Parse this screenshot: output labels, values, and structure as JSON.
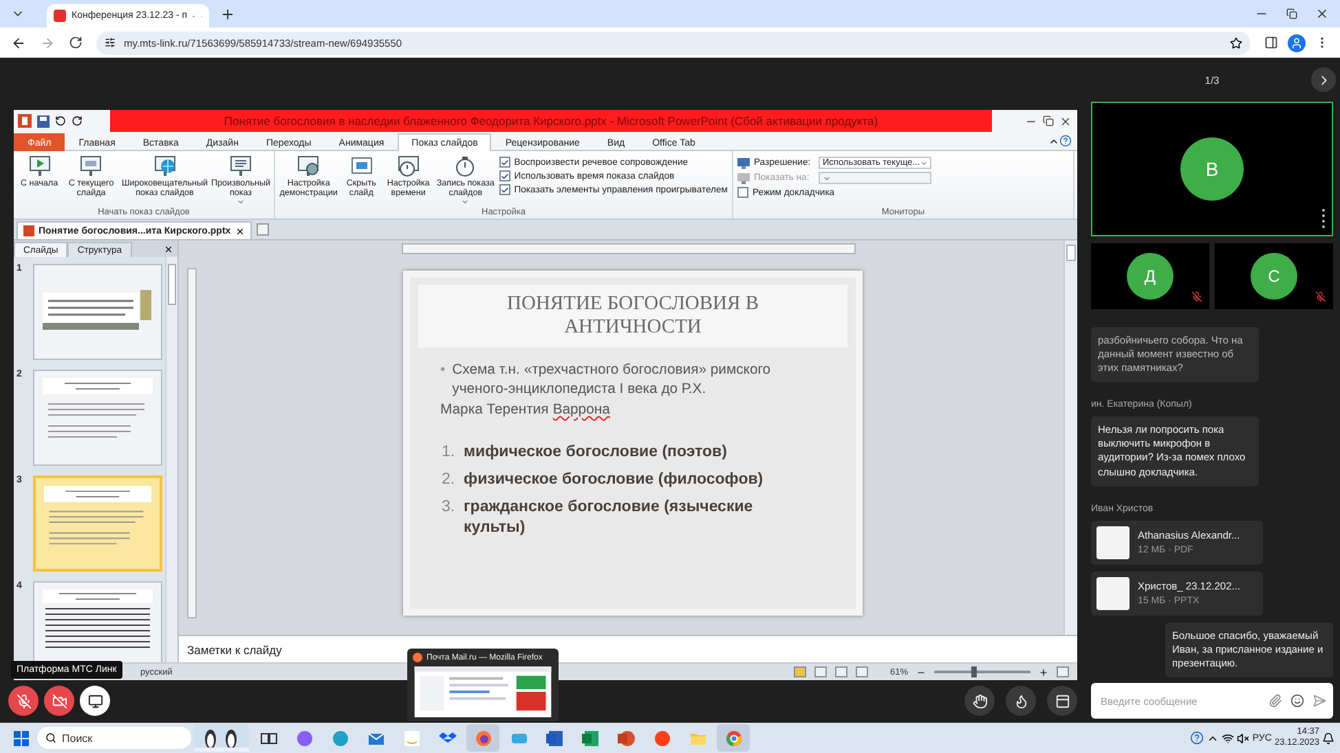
{
  "browser": {
    "tab_title": "Конференция 23.12.23 - п",
    "audio_playing": true,
    "url": "my.mts-link.ru/71563699/585914733/stream-new/694935550"
  },
  "powerpoint": {
    "window_title": "Понятие богословия в наследии блаженного Феодорита Кирского.pptx - Microsoft PowerPoint (Сбой активации продукта)",
    "tabs": [
      {
        "label": "Файл",
        "kind": "file",
        "selected": false
      },
      {
        "label": "Главная",
        "kind": "tab",
        "selected": false
      },
      {
        "label": "Вставка",
        "kind": "tab",
        "selected": false
      },
      {
        "label": "Дизайн",
        "kind": "tab",
        "selected": false
      },
      {
        "label": "Переходы",
        "kind": "tab",
        "selected": false
      },
      {
        "label": "Анимация",
        "kind": "tab",
        "selected": false
      },
      {
        "label": "Показ слайдов",
        "kind": "tab",
        "selected": true
      },
      {
        "label": "Рецензирование",
        "kind": "tab",
        "selected": false
      },
      {
        "label": "Вид",
        "kind": "tab",
        "selected": false
      },
      {
        "label": "Office Tab",
        "kind": "tab",
        "selected": false
      }
    ],
    "ribbon_groups": [
      {
        "label": "Начать показ слайдов",
        "items": [
          {
            "kind": "button",
            "label": "С начала",
            "has_menu": false
          },
          {
            "kind": "button",
            "label": "С текущего слайда",
            "has_menu": false
          },
          {
            "kind": "button",
            "label": "Широковещательный показ слайдов",
            "has_menu": false
          },
          {
            "kind": "button",
            "label": "Произвольный показ",
            "has_menu": true
          }
        ]
      },
      {
        "label": "Настройка",
        "items": [
          {
            "kind": "button",
            "label": "Настройка демонстрации",
            "has_menu": false
          },
          {
            "kind": "button",
            "label": "Скрыть слайд",
            "has_menu": false
          },
          {
            "kind": "button",
            "label": "Настройка времени",
            "has_menu": false
          },
          {
            "kind": "button",
            "label": "Запись показа слайдов",
            "has_menu": true
          },
          {
            "kind": "checkboxes",
            "checkboxes": [
              {
                "label": "Воспроизвести речевое сопровождение",
                "checked": true
              },
              {
                "label": "Использовать время показа слайдов",
                "checked": true
              },
              {
                "label": "Показать элементы управления проигрывателем",
                "checked": true
              }
            ]
          }
        ]
      },
      {
        "label": "Мониторы",
        "items": [
          {
            "kind": "monitors",
            "rows": [
              {
                "label": "Разрешение:",
                "value": "Использовать текуще...",
                "disabled": false
              },
              {
                "label": "Показать на:",
                "disabled": true
              }
            ],
            "checkbox": {
              "label": "Режим докладчика",
              "checked": false
            }
          }
        ]
      }
    ],
    "document_tab": "Понятие богословия...ита Кирского.pptx",
    "pane_tabs": [
      {
        "label": "Слайды",
        "selected": true
      },
      {
        "label": "Структура",
        "selected": false
      }
    ],
    "slides": [
      {
        "number": "1",
        "selected": false
      },
      {
        "number": "2",
        "selected": false
      },
      {
        "number": "3",
        "selected": true
      },
      {
        "number": "4",
        "selected": false
      }
    ],
    "slide": {
      "title": "ПОНЯТИЕ БОГОСЛОВИЯ В АНТИЧНОСТИ",
      "bullet_mark": "•",
      "bullet": "Схема т.н. «трехчастного богословия» римского ученого-энциклопедиста I века до Р.Х.",
      "line": "Марка Терентия",
      "misspelled": "Варрона",
      "list": [
        {
          "number": "1.",
          "text": "мифическое богословие (поэтов)"
        },
        {
          "number": "2.",
          "text": "физическое богословие (философов)"
        },
        {
          "number": "3.",
          "text": "гражданское богословие (языческие культы)"
        }
      ]
    },
    "notes_placeholder": "Заметки к слайду",
    "status": {
      "language": "русский",
      "zoom": {
        "reading": "61%",
        "level": 0.42
      }
    }
  },
  "conference": {
    "page": "1/3",
    "tiles": [
      {
        "initial": "В",
        "speaking": true,
        "muted": false
      },
      {
        "initial": "Д",
        "speaking": false,
        "muted": true
      },
      {
        "initial": "С",
        "speaking": false,
        "muted": true
      }
    ],
    "chat": [
      {
        "kind": "message",
        "text": "разбойничьего собора. Что на данный момент известно об этих памятниках?"
      },
      {
        "kind": "sender",
        "text": "ин. Екатерина (Копыл)"
      },
      {
        "kind": "message",
        "text": "Нельзя ли попросить пока выключить микрофон в аудитории? Из-за помех плохо слышно докладчика."
      },
      {
        "kind": "sender",
        "text": "Иван Христов"
      },
      {
        "kind": "file",
        "name": "Athanasius Alexandr...",
        "meta": "12 МБ · PDF"
      },
      {
        "kind": "file",
        "name": "Христов_ 23.12.202...",
        "meta": "15 МБ · PPTX"
      },
      {
        "kind": "own",
        "text": "Большое спасибо, уважаемый Иван, за присланное издание и презентацию."
      }
    ],
    "message_placeholder": "Введите сообщение",
    "controls": {
      "mic_on": false,
      "camera_on": false
    }
  },
  "tooltip": "Платформа МТС Линк",
  "preview": {
    "title": "Почта Mail.ru — Mozilla Firefox"
  },
  "taskbar": {
    "search_placeholder": "Поиск",
    "apps": [
      {
        "kind": "taskview",
        "active": false
      },
      {
        "kind": "assistant",
        "active": false
      },
      {
        "kind": "edge",
        "active": false
      },
      {
        "kind": "mail",
        "active": false
      },
      {
        "kind": "store",
        "active": false
      },
      {
        "kind": "dropbox",
        "active": false
      },
      {
        "kind": "firefox",
        "active": true
      },
      {
        "kind": "weather",
        "active": false
      },
      {
        "kind": "word",
        "active": false
      },
      {
        "kind": "excel",
        "active": false
      },
      {
        "kind": "powerpoint",
        "active": false
      },
      {
        "kind": "yandex",
        "active": false
      },
      {
        "kind": "folder",
        "active": false
      },
      {
        "kind": "chrome",
        "active": true
      }
    ],
    "language": "РУС",
    "time": "14:37",
    "date": "23.12.2023"
  }
}
